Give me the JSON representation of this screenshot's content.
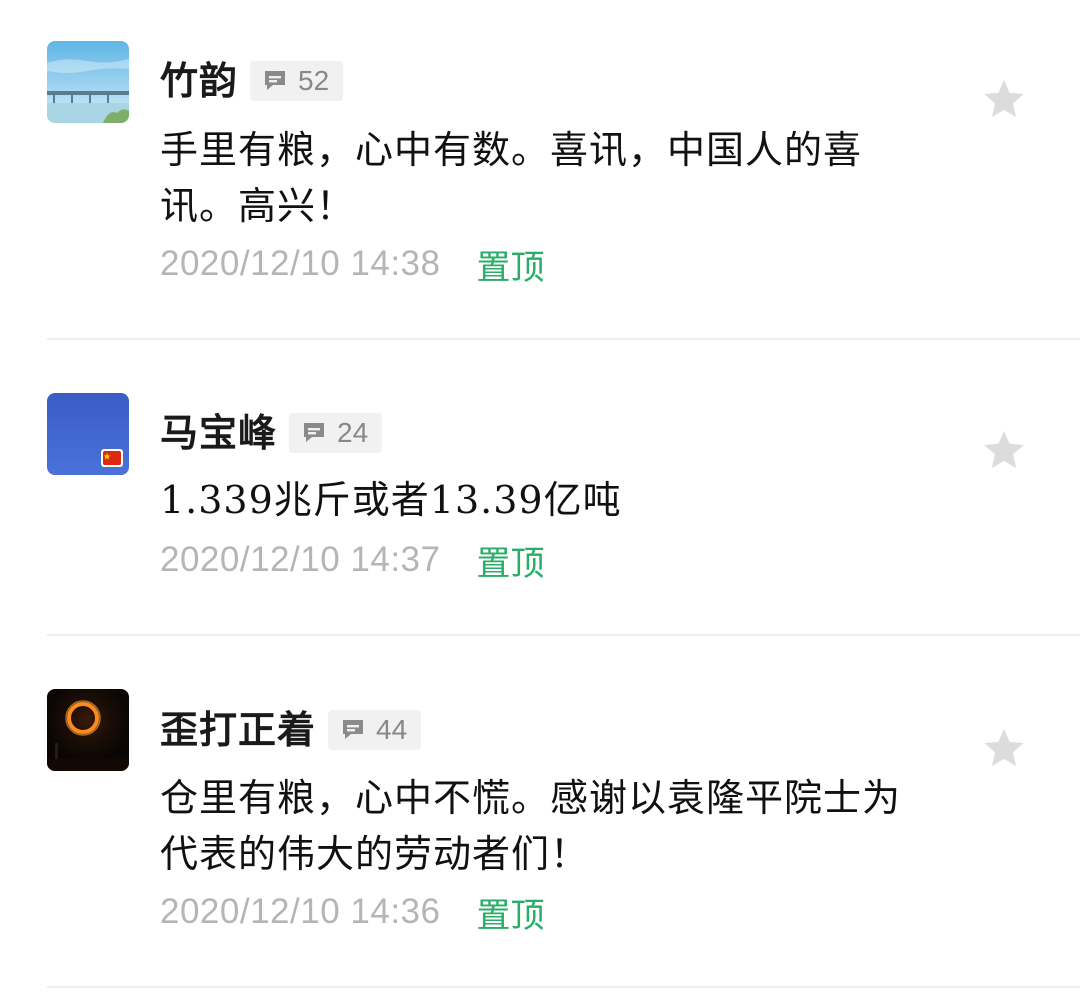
{
  "comments": [
    {
      "name": "竹韵",
      "reply_count": "52",
      "text": "手里有粮，心中有数。喜讯，中国人的喜讯。高兴！",
      "time": "2020/12/10 14:38",
      "pin_label": "置顶",
      "avatar": "avatar-bridge-sky"
    },
    {
      "name": "马宝峰",
      "reply_count": "24",
      "text": "1.339兆斤或者13.39亿吨",
      "time": "2020/12/10 14:37",
      "pin_label": "置顶",
      "avatar": "avatar-blue-flag"
    },
    {
      "name": "歪打正着",
      "reply_count": "44",
      "text": "仓里有粮，心中不慌。感谢以袁隆平院士为代表的伟大的劳动者们！",
      "time": "2020/12/10 14:36",
      "pin_label": "置顶",
      "avatar": "avatar-eclipse"
    }
  ],
  "icons": {
    "reply": "comment-bubble-icon",
    "favorite": "star-icon"
  },
  "colors": {
    "pin": "#2aae67",
    "time": "#b5b5b5",
    "badge_bg": "#f1f1f1",
    "star": "#dcdcdc"
  }
}
